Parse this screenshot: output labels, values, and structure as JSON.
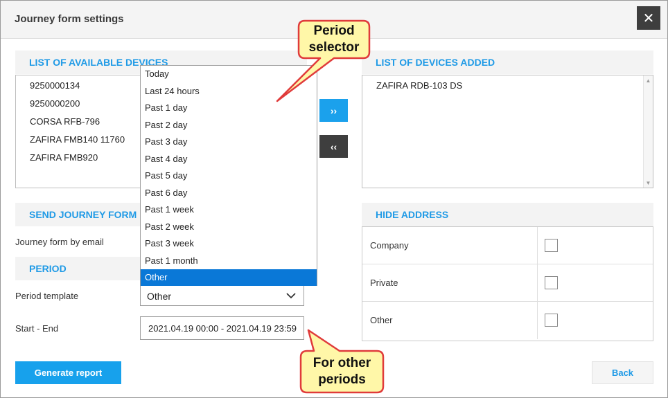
{
  "dialog": {
    "title": "Journey form settings",
    "close_icon": "close-icon",
    "close_glyph": "✕"
  },
  "available": {
    "header": "LIST OF AVAILABLE DEVICES",
    "items": [
      "9250000134",
      "9250000200",
      "CORSA RFB-796",
      "ZAFIRA FMB140 11760",
      "ZAFIRA FMB920"
    ]
  },
  "added": {
    "header": "LIST OF DEVICES ADDED",
    "items": [
      "ZAFIRA RDB-103 DS"
    ]
  },
  "transfer": {
    "add_label": "››",
    "remove_label": "‹‹",
    "add_color": "#1ba1ec",
    "remove_color": "#3e3e3e"
  },
  "send": {
    "header": "SEND JOURNEY FORM",
    "email_label": "Journey form by email"
  },
  "period": {
    "header": "PERIOD",
    "template_label": "Period template",
    "template_value": "Other",
    "chevron_icon": "chevron-down-icon",
    "range_label": "Start - End",
    "range_value": "2021.04.19 00:00 - 2021.04.19 23:59"
  },
  "dropdown": {
    "options": [
      "Today",
      "Last 24 hours",
      "Past 1 day",
      "Past 2 day",
      "Past 3 day",
      "Past 4 day",
      "Past 5 day",
      "Past 6 day",
      "Past 1 week",
      "Past 2 week",
      "Past 3 week",
      "Past 1 month",
      "Other"
    ],
    "selected": "Other"
  },
  "hide_address": {
    "header": "HIDE ADDRESS",
    "rows": [
      "Company",
      "Private",
      "Other"
    ]
  },
  "footer": {
    "generate_label": "Generate report",
    "back_label": "Back"
  },
  "callouts": {
    "period_selector": [
      "Period",
      "selector"
    ],
    "other_periods": [
      "For other",
      "periods"
    ],
    "fill": "#fff7a8",
    "stroke": "#e03b3b"
  },
  "colors": {
    "accent": "#1f9ae6",
    "selected": "#0a78d7"
  }
}
